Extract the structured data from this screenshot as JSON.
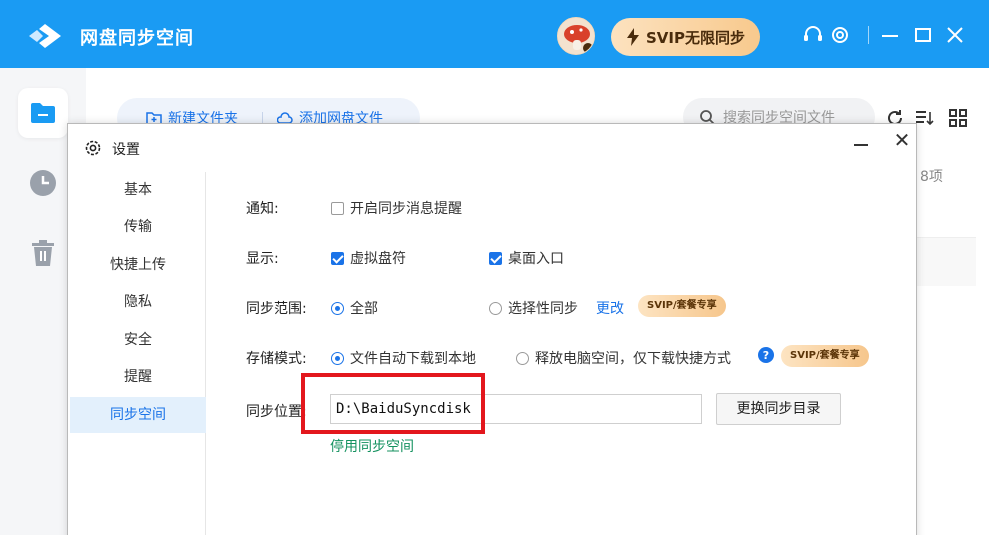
{
  "app": {
    "title": "网盘同步空间",
    "svip_label": "SVIP无限同步",
    "colors": {
      "accent": "#1a9bf3",
      "link": "#1a73e8",
      "highlight": "#e3171d"
    }
  },
  "titlebar_icons": [
    "headset-icon",
    "gear-icon",
    "minimize-icon",
    "maximize-icon",
    "close-icon"
  ],
  "nav": {
    "items": [
      {
        "icon": "folder-icon",
        "active": true
      },
      {
        "icon": "clock-icon",
        "active": false
      },
      {
        "icon": "trash-icon",
        "active": false
      }
    ]
  },
  "main": {
    "new_folder": "新建文件夹",
    "add_files": "添加网盘文件",
    "search_placeholder": "搜索同步空间文件",
    "count": "8项"
  },
  "dialog": {
    "title": "设置",
    "sidebar": [
      "基本",
      "传输",
      "快捷上传",
      "隐私",
      "安全",
      "提醒",
      "同步空间"
    ],
    "active_index": 6,
    "notify_label": "通知:",
    "notify_option": "开启同步消息提醒",
    "notify_checked": false,
    "display_label": "显示:",
    "display_options": [
      {
        "label": "虚拟盘符",
        "checked": true
      },
      {
        "label": "桌面入口",
        "checked": true
      }
    ],
    "scope_label": "同步范围:",
    "scope_all": "全部",
    "scope_selective": "选择性同步",
    "scope_change": "更改",
    "storage_label": "存储模式:",
    "storage_auto": "文件自动下载到本地",
    "storage_free": "释放电脑空间，仅下载快捷方式",
    "badge": "SVIP/套餐专享",
    "location_label": "同步位置:",
    "location_value": "D:\\BaiduSyncdisk",
    "change_dir": "更换同步目录",
    "stop_sync": "停用同步空间"
  }
}
